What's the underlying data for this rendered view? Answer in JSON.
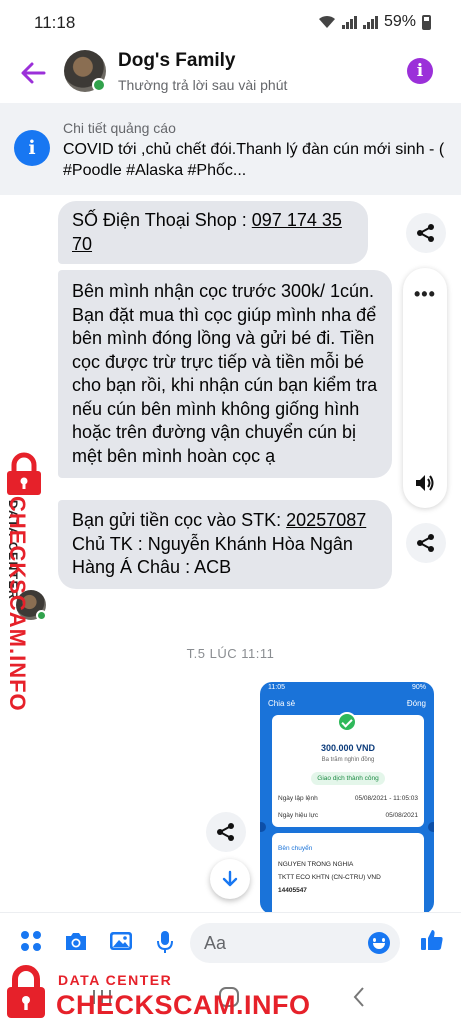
{
  "status_bar": {
    "time": "11:18",
    "battery": "59%"
  },
  "header": {
    "name": "Dog's Family",
    "subtitle": "Thường trả lời sau vài phút"
  },
  "ad": {
    "label": "Chi tiết quảng cáo",
    "title": "COVID tới ,chủ chết đói.Thanh lý đàn cún mới sinh - ( #Poodle #Alaska #Phốc..."
  },
  "messages": {
    "m1": {
      "prefix": "SỐ Điện Thoại Shop : ",
      "phone": "097 174 35 70"
    },
    "m2": {
      "text": "Bên mình nhận cọc trước 300k/ 1cún. Bạn đặt mua thì cọc giúp mình nha để bên mình đóng lồng và gửi bé đi. Tiền cọc được trừ trực tiếp và tiền mỗi bé cho bạn rồi, khi nhận cún bạn kiểm tra nếu cún bên mình không giống hình hoặc trên đường vận chuyển cún bị mệt bên mình hoàn cọc ạ"
    },
    "m3": {
      "prefix": "Bạn gửi tiền cọc vào STK: ",
      "account": "20257087",
      "suffix": " Chủ TK : Nguyễn Khánh Hòa Ngân Hàng Á Châu : ACB"
    }
  },
  "timestamp": "T.5 LÚC 11:11",
  "transfer_screenshot": {
    "status_time": "11:05",
    "status_battery": "90%",
    "share_label": "Chia sẻ",
    "close_label": "Đóng",
    "amount": "300.000 VND",
    "amount_words": "Ba trăm nghìn đồng",
    "status": "Giao dịch thành công",
    "created_label": "Ngày lập lệnh",
    "created_value": "05/08/2021 - 11:05:03",
    "effective_label": "Ngày hiệu lực",
    "effective_value": "05/08/2021",
    "sender_label": "Bên chuyển",
    "sender_name": "NGUYEN TRONG NGHIA",
    "sender_account": "TKTT ECO KHTN (CN-CTRU) VND",
    "sender_number": "14405547"
  },
  "composer": {
    "placeholder": "Aa"
  },
  "watermark": {
    "data_center": "DATA CENTER",
    "site": "CHECKSCAM.INFO"
  },
  "icons": [
    "back-arrow-icon",
    "info-icon",
    "share-icon",
    "more-dots-icon",
    "speaker-icon",
    "scroll-down-icon",
    "apps-icon",
    "camera-icon",
    "image-icon",
    "microphone-icon",
    "emoji-icon",
    "like-icon"
  ],
  "colors": {
    "accent": "#9b30d9",
    "messenger_blue": "#1877f2",
    "online": "#31a24c",
    "bubble": "#e4e6eb",
    "watermark_red": "#e6212a"
  }
}
